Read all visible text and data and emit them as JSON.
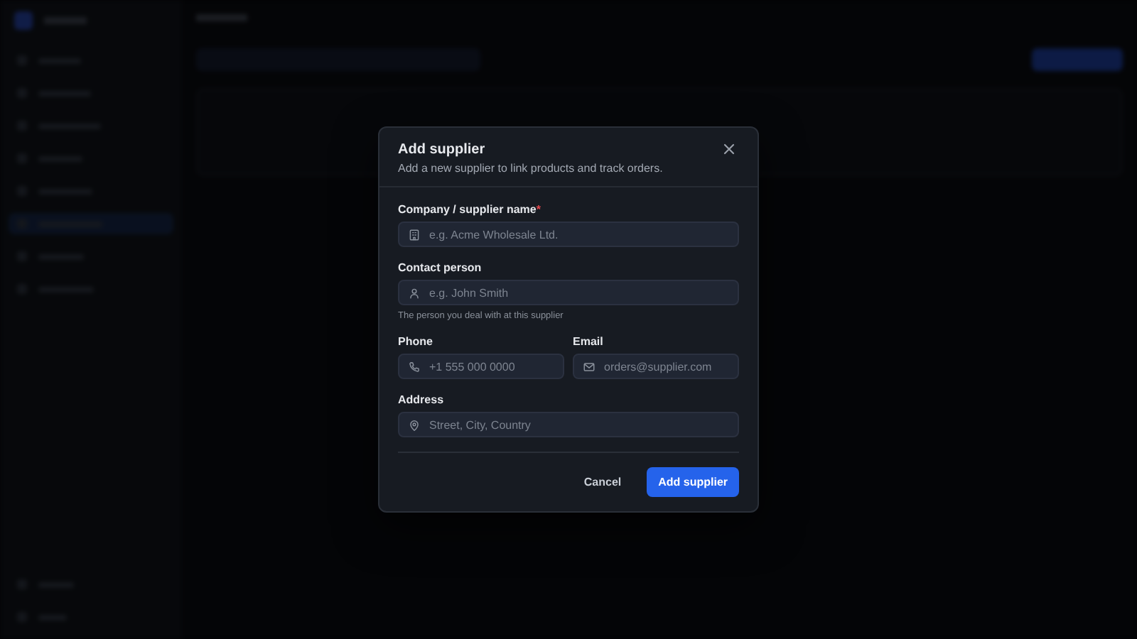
{
  "dialog": {
    "title": "Add supplier",
    "subtitle": "Add a new supplier to link products and track orders.",
    "rows": [
      [
        {
          "label": "Company / supplier name",
          "required_mark": "*",
          "kind": "building",
          "placeholder": "e.g. Acme Wholesale Ltd."
        }
      ],
      [
        {
          "label": "Contact person",
          "kind": "person",
          "placeholder": "e.g. John Smith",
          "hint": "The person you deal with at this supplier"
        }
      ],
      [
        {
          "label": "Phone",
          "kind": "phone",
          "placeholder": "+1 555 000 0000"
        },
        {
          "label": "Email",
          "kind": "mail",
          "placeholder": "orders@supplier.com"
        }
      ],
      [
        {
          "label": "Address",
          "kind": "pin",
          "placeholder": "Street, City, Country"
        }
      ]
    ],
    "buttons": [
      {
        "kind": "secondary",
        "label": "Cancel"
      },
      {
        "kind": "primary",
        "label": "Add supplier"
      }
    ]
  }
}
